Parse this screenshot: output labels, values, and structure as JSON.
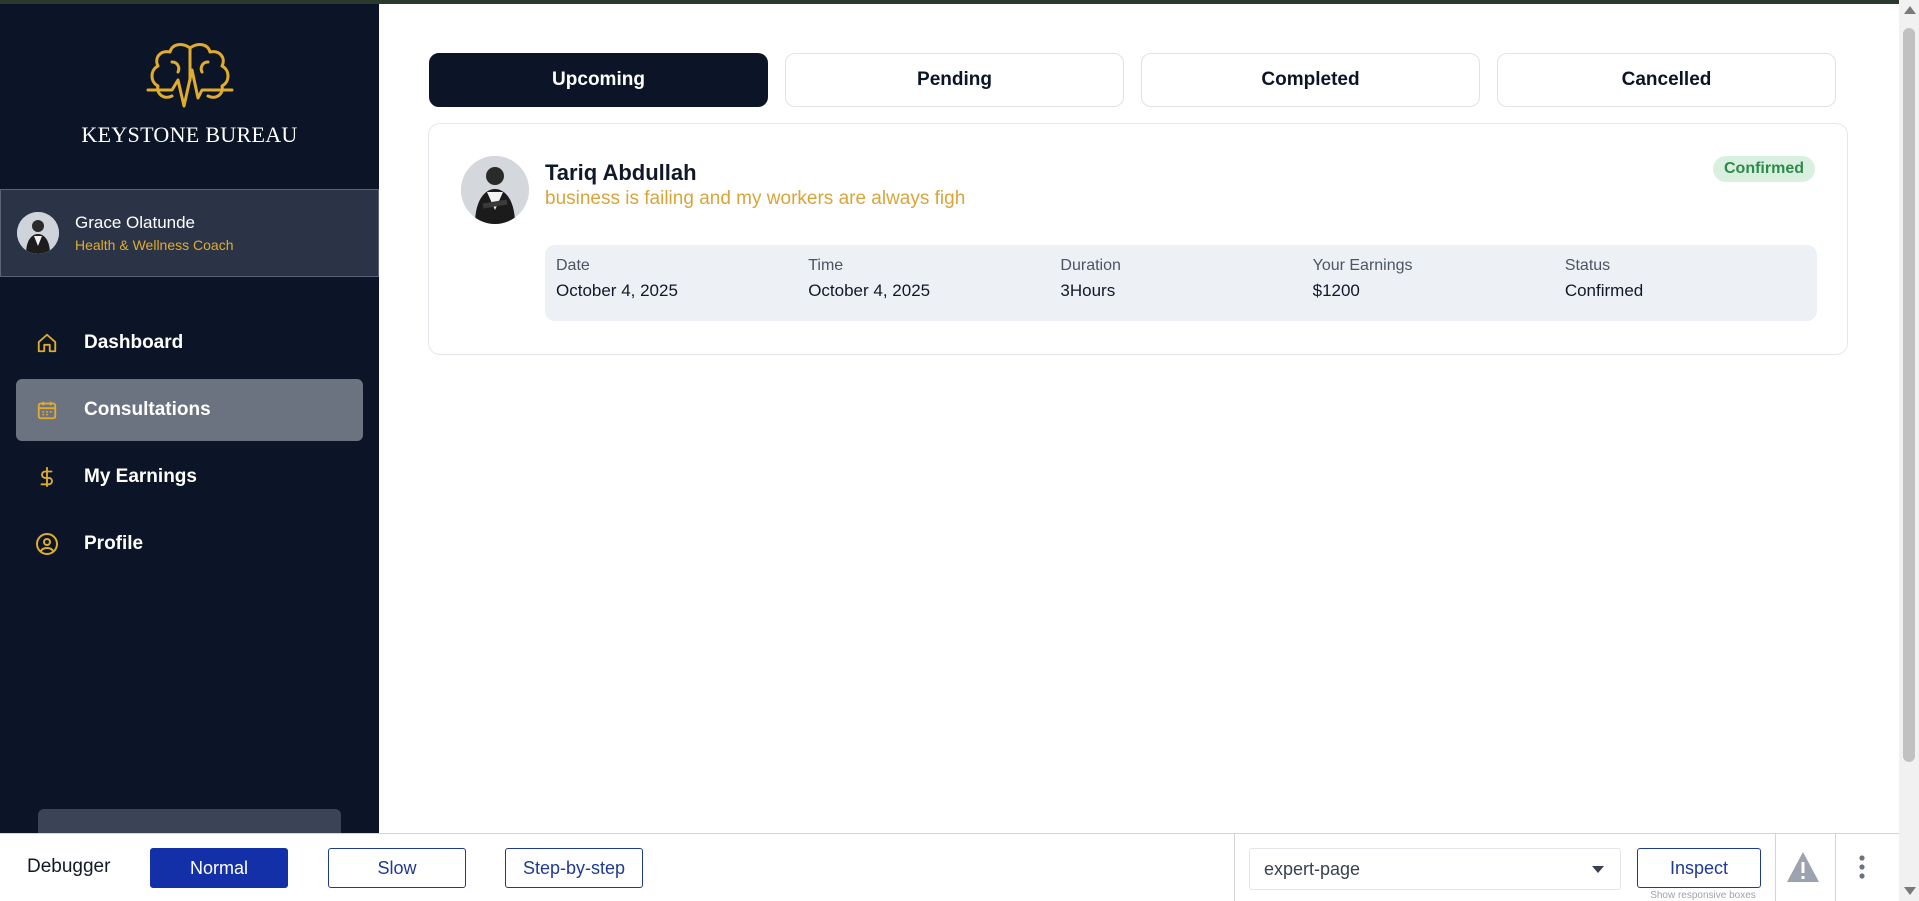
{
  "brand": {
    "name": "KEYSTONE BUREAU"
  },
  "user": {
    "name": "Grace Olatunde",
    "role": "Health & Wellness Coach"
  },
  "nav": {
    "items": [
      {
        "label": "Dashboard",
        "icon": "home-icon"
      },
      {
        "label": "Consultations",
        "icon": "calendar-icon",
        "active": true
      },
      {
        "label": "My Earnings",
        "icon": "dollar-icon"
      },
      {
        "label": "Profile",
        "icon": "user-circle-icon"
      }
    ]
  },
  "tabs": [
    {
      "label": "Upcoming",
      "active": true
    },
    {
      "label": "Pending"
    },
    {
      "label": "Completed"
    },
    {
      "label": "Cancelled"
    }
  ],
  "consultation": {
    "client_name": "Tariq Abdullah",
    "message": "business is failing and my workers are always figh",
    "badge": "Confirmed",
    "details": [
      {
        "label": "Date",
        "value": "October 4, 2025"
      },
      {
        "label": "Time",
        "value": "October 4, 2025"
      },
      {
        "label": "Duration",
        "value": "3Hours"
      },
      {
        "label": "Your Earnings",
        "value": "$1200"
      },
      {
        "label": "Status",
        "value": "Confirmed"
      }
    ]
  },
  "debugger": {
    "title": "Debugger",
    "modes": [
      "Normal",
      "Slow",
      "Step-by-step"
    ],
    "selected_mode": "Normal",
    "page_select": "expert-page",
    "inspect_label": "Inspect",
    "inspect_hint": "Show responsive boxes"
  },
  "colors": {
    "sidebar_bg": "#0c1527",
    "accent_gold": "#e0ac2e",
    "badge_green": "#2e8a49",
    "debugger_primary": "#1430a8"
  }
}
